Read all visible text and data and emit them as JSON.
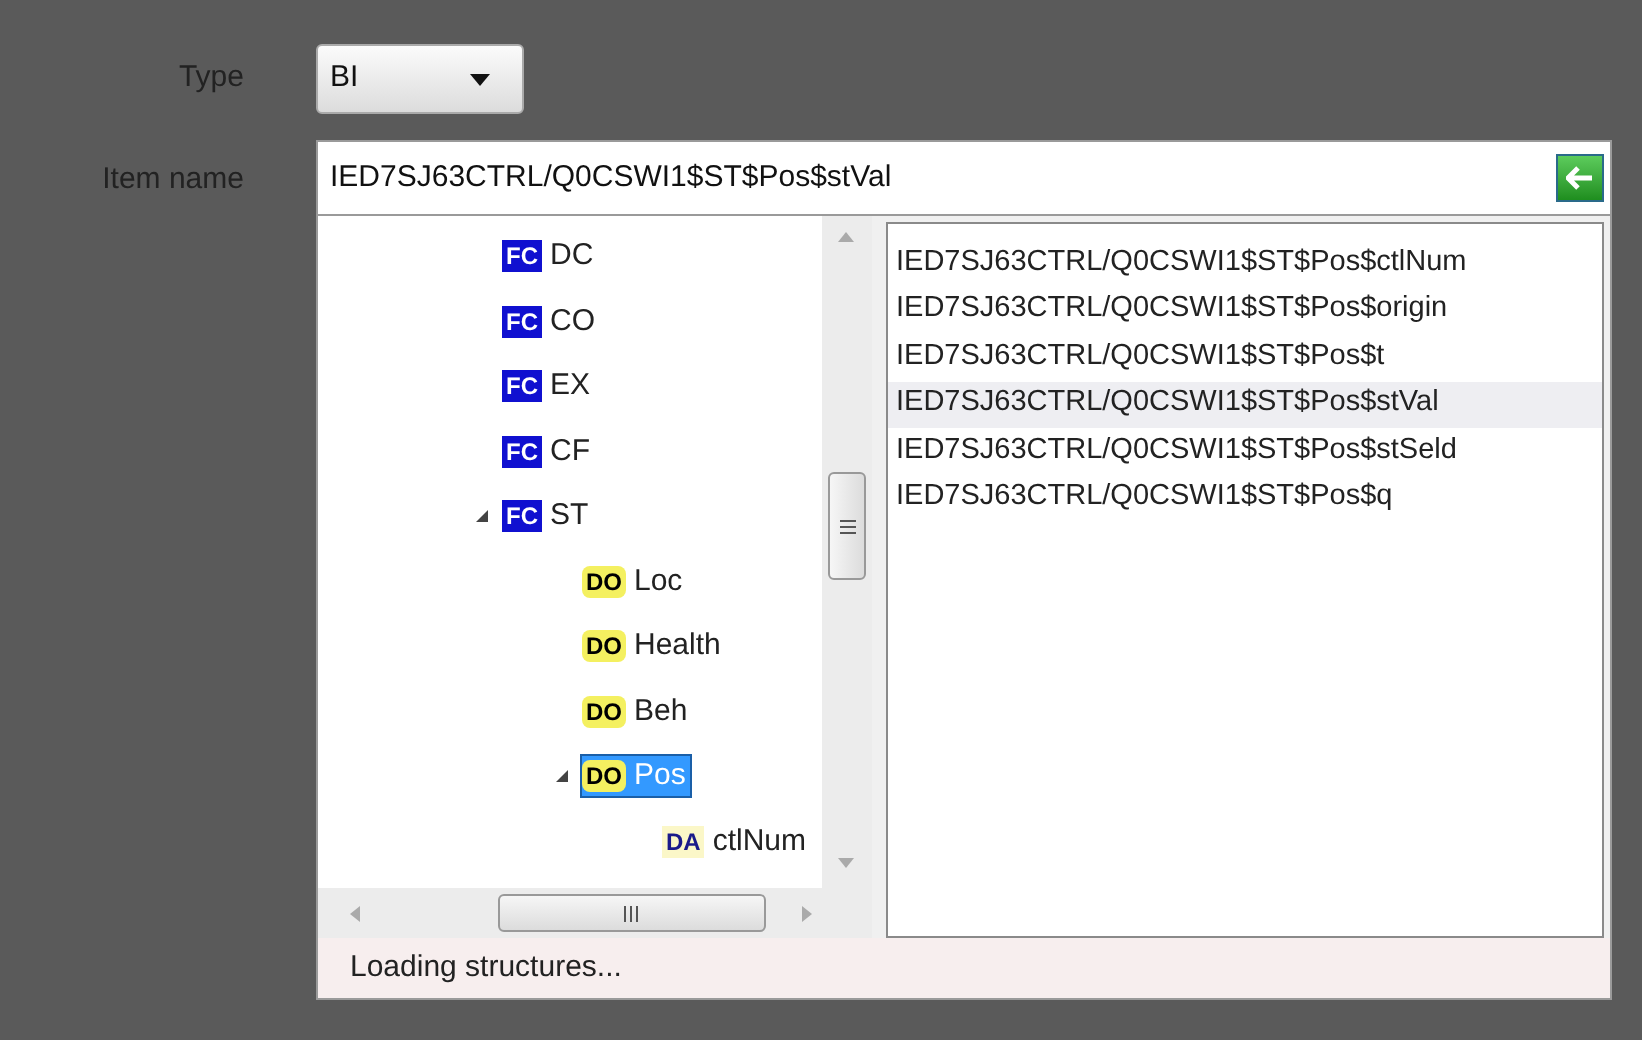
{
  "form": {
    "type_label": "Type",
    "type_value": "BI",
    "item_label": "Item name",
    "item_value": "IED7SJ63CTRL/Q0CSWI1$ST$Pos$stVal"
  },
  "tree": {
    "items": [
      {
        "badge": "FC",
        "kind": "fc",
        "label": "DC",
        "selected": false
      },
      {
        "badge": "FC",
        "kind": "fc",
        "label": "CO",
        "selected": false
      },
      {
        "badge": "FC",
        "kind": "fc",
        "label": "EX",
        "selected": false
      },
      {
        "badge": "FC",
        "kind": "fc",
        "label": "CF",
        "selected": false
      },
      {
        "badge": "FC",
        "kind": "fc",
        "label": "ST",
        "selected": false,
        "expanded": true,
        "children": [
          {
            "badge": "DO",
            "kind": "do",
            "label": "Loc",
            "selected": false
          },
          {
            "badge": "DO",
            "kind": "do",
            "label": "Health",
            "selected": false
          },
          {
            "badge": "DO",
            "kind": "do",
            "label": "Beh",
            "selected": false
          },
          {
            "badge": "DO",
            "kind": "do",
            "label": "Pos",
            "selected": true,
            "expanded": true,
            "children": [
              {
                "badge": "DA",
                "kind": "da",
                "label": "ctlNum",
                "selected": false
              }
            ]
          }
        ]
      }
    ]
  },
  "list": [
    {
      "text": "IED7SJ63CTRL/Q0CSWI1$ST$Pos$ctlNum",
      "selected": false
    },
    {
      "text": "IED7SJ63CTRL/Q0CSWI1$ST$Pos$origin",
      "selected": false
    },
    {
      "text": "IED7SJ63CTRL/Q0CSWI1$ST$Pos$t",
      "selected": false
    },
    {
      "text": "IED7SJ63CTRL/Q0CSWI1$ST$Pos$stVal",
      "selected": true
    },
    {
      "text": "IED7SJ63CTRL/Q0CSWI1$ST$Pos$stSeld",
      "selected": false
    },
    {
      "text": "IED7SJ63CTRL/Q0CSWI1$ST$Pos$q",
      "selected": false
    }
  ],
  "status": "Loading structures..."
}
